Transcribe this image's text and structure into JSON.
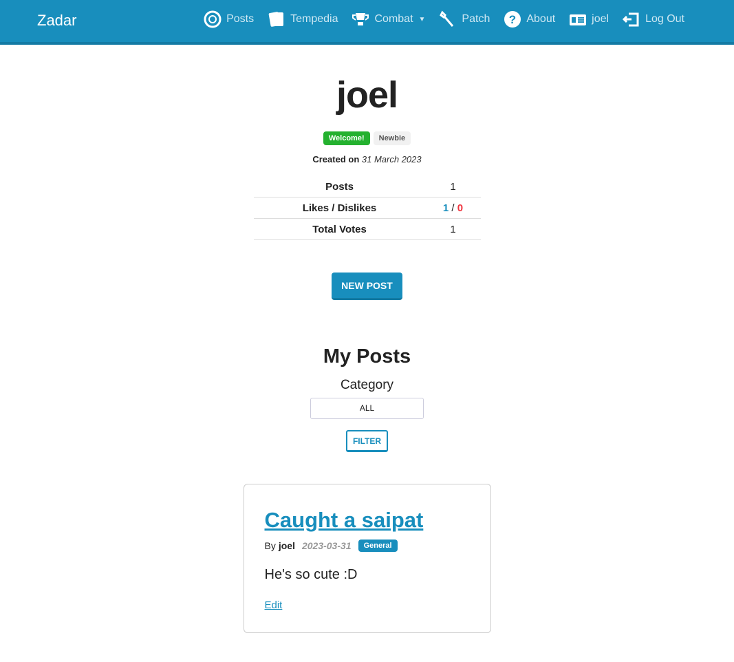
{
  "nav": {
    "brand": "Zadar",
    "items": [
      {
        "label": "Posts",
        "icon": "coin-icon"
      },
      {
        "label": "Tempedia",
        "icon": "cards-icon"
      },
      {
        "label": "Combat",
        "icon": "trophy-icon"
      },
      {
        "label": "Patch",
        "icon": "wrench-icon"
      },
      {
        "label": "About",
        "icon": "question-icon"
      },
      {
        "label": "joel",
        "icon": "id-card-icon"
      },
      {
        "label": "Log Out",
        "icon": "logout-icon"
      }
    ]
  },
  "profile": {
    "username": "joel",
    "badges": [
      "Welcome!",
      "Newbie"
    ],
    "created_label": "Created on",
    "created_date": "31 March 2023",
    "stats": {
      "posts_label": "Posts",
      "posts": "1",
      "likes_label": "Likes / Dislikes",
      "likes": "1",
      "sep": "/",
      "dislikes": "0",
      "votes_label": "Total Votes",
      "votes": "1"
    },
    "new_post": "NEW POST"
  },
  "my_posts": {
    "heading": "My Posts",
    "category_label": "Category",
    "category_value": "ALL",
    "filter": "FILTER",
    "posts": [
      {
        "title": "Caught a saipat",
        "by": "By",
        "author": "joel",
        "date": "2023-03-31",
        "category": "General",
        "body": "He's so cute :D",
        "edit": "Edit"
      }
    ]
  },
  "colors": {
    "primary": "#188ebd",
    "success": "#24b12f",
    "danger": "#f0353f"
  }
}
